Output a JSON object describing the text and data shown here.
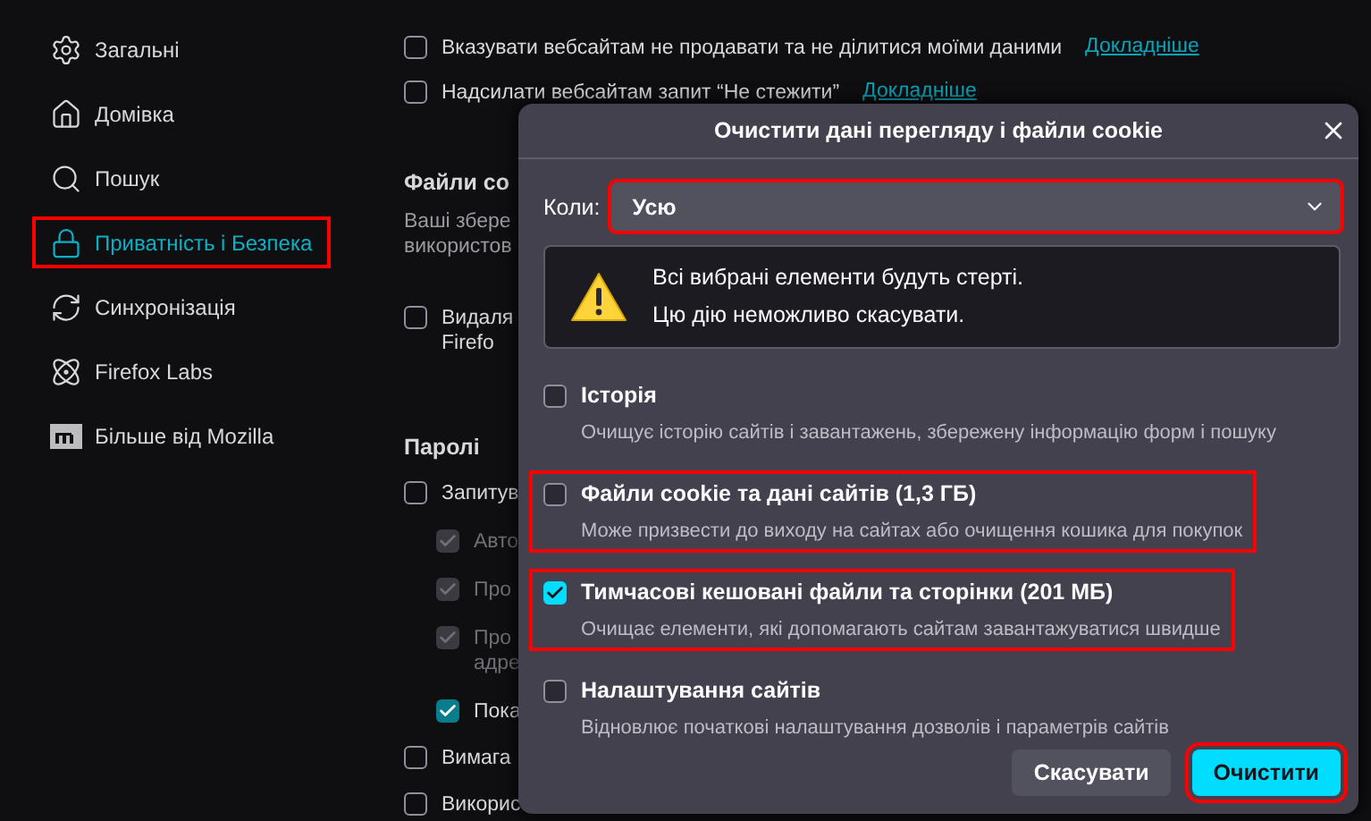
{
  "sidebar": {
    "items": [
      {
        "label": "Загальні",
        "selected": false
      },
      {
        "label": "Домівка",
        "selected": false
      },
      {
        "label": "Пошук",
        "selected": false
      },
      {
        "label": "Приватність і Безпека",
        "selected": true,
        "highlighted": true
      },
      {
        "label": "Синхронізація",
        "selected": false
      },
      {
        "label": "Firefox Labs",
        "selected": false
      },
      {
        "label": "Більше від Mozilla",
        "selected": false
      }
    ]
  },
  "content": {
    "rows": [
      {
        "kind": "checkbox",
        "label": "Вказувати вебсайтам не продавати та не ділитися моїми даними",
        "link": "Докладніше",
        "checked": false
      },
      {
        "kind": "checkbox",
        "label": "Надсилати вебсайтам запит “Не стежити”",
        "link": "Докладніше",
        "checked": false
      },
      {
        "kind": "heading",
        "label": "Файли co"
      },
      {
        "kind": "text",
        "label": "Ваші збере\nвикористов"
      },
      {
        "kind": "checkbox",
        "label": "Видаля\nFirefo",
        "checked": false
      },
      {
        "kind": "heading",
        "label": "Паролі"
      },
      {
        "kind": "checkbox",
        "label": "Запитув",
        "checked": false,
        "children": [
          {
            "label": "Авто",
            "checked": true,
            "disabled": true
          },
          {
            "label": "Про",
            "checked": true,
            "disabled": true
          },
          {
            "label": "Про\nадре",
            "checked": true,
            "disabled": true
          },
          {
            "label": "Пока",
            "checked": true,
            "disabled": false
          }
        ]
      },
      {
        "kind": "checkbox",
        "label": "Вимага",
        "checked": false
      },
      {
        "kind": "checkbox",
        "label": "Викорис",
        "checked": false
      }
    ]
  },
  "dialog": {
    "title": "Очистити дані перегляду і файли cookie",
    "time_range": {
      "label": "Коли:",
      "value": "Усю",
      "highlighted": true
    },
    "warning": [
      "Всі вибрані елементи будуть стерті.",
      "Цю дію неможливо скасувати."
    ],
    "options": [
      {
        "label": "Історія",
        "description": "Очищує історію сайтів і завантажень, збережену інформацію форм і пошуку",
        "checked": false
      },
      {
        "label": "Файли cookie та дані сайтів (1,3 ГБ)",
        "description": "Може призвести до виходу на сайтах або очищення кошика для покупок",
        "checked": false,
        "highlighted": true
      },
      {
        "label": "Тимчасові кешовані файли та сторінки (201 МБ)",
        "description": "Очищає елементи, які допомагають сайтам завантажуватися швидше",
        "checked": true,
        "highlighted": true
      },
      {
        "label": "Налаштування сайтів",
        "description": "Відновлює початкові налаштування дозволів і параметрів сайтів",
        "checked": false
      }
    ],
    "buttons": [
      {
        "label": "Скасувати",
        "primary": false
      },
      {
        "label": "Очистити",
        "primary": true,
        "highlighted": true
      }
    ]
  }
}
